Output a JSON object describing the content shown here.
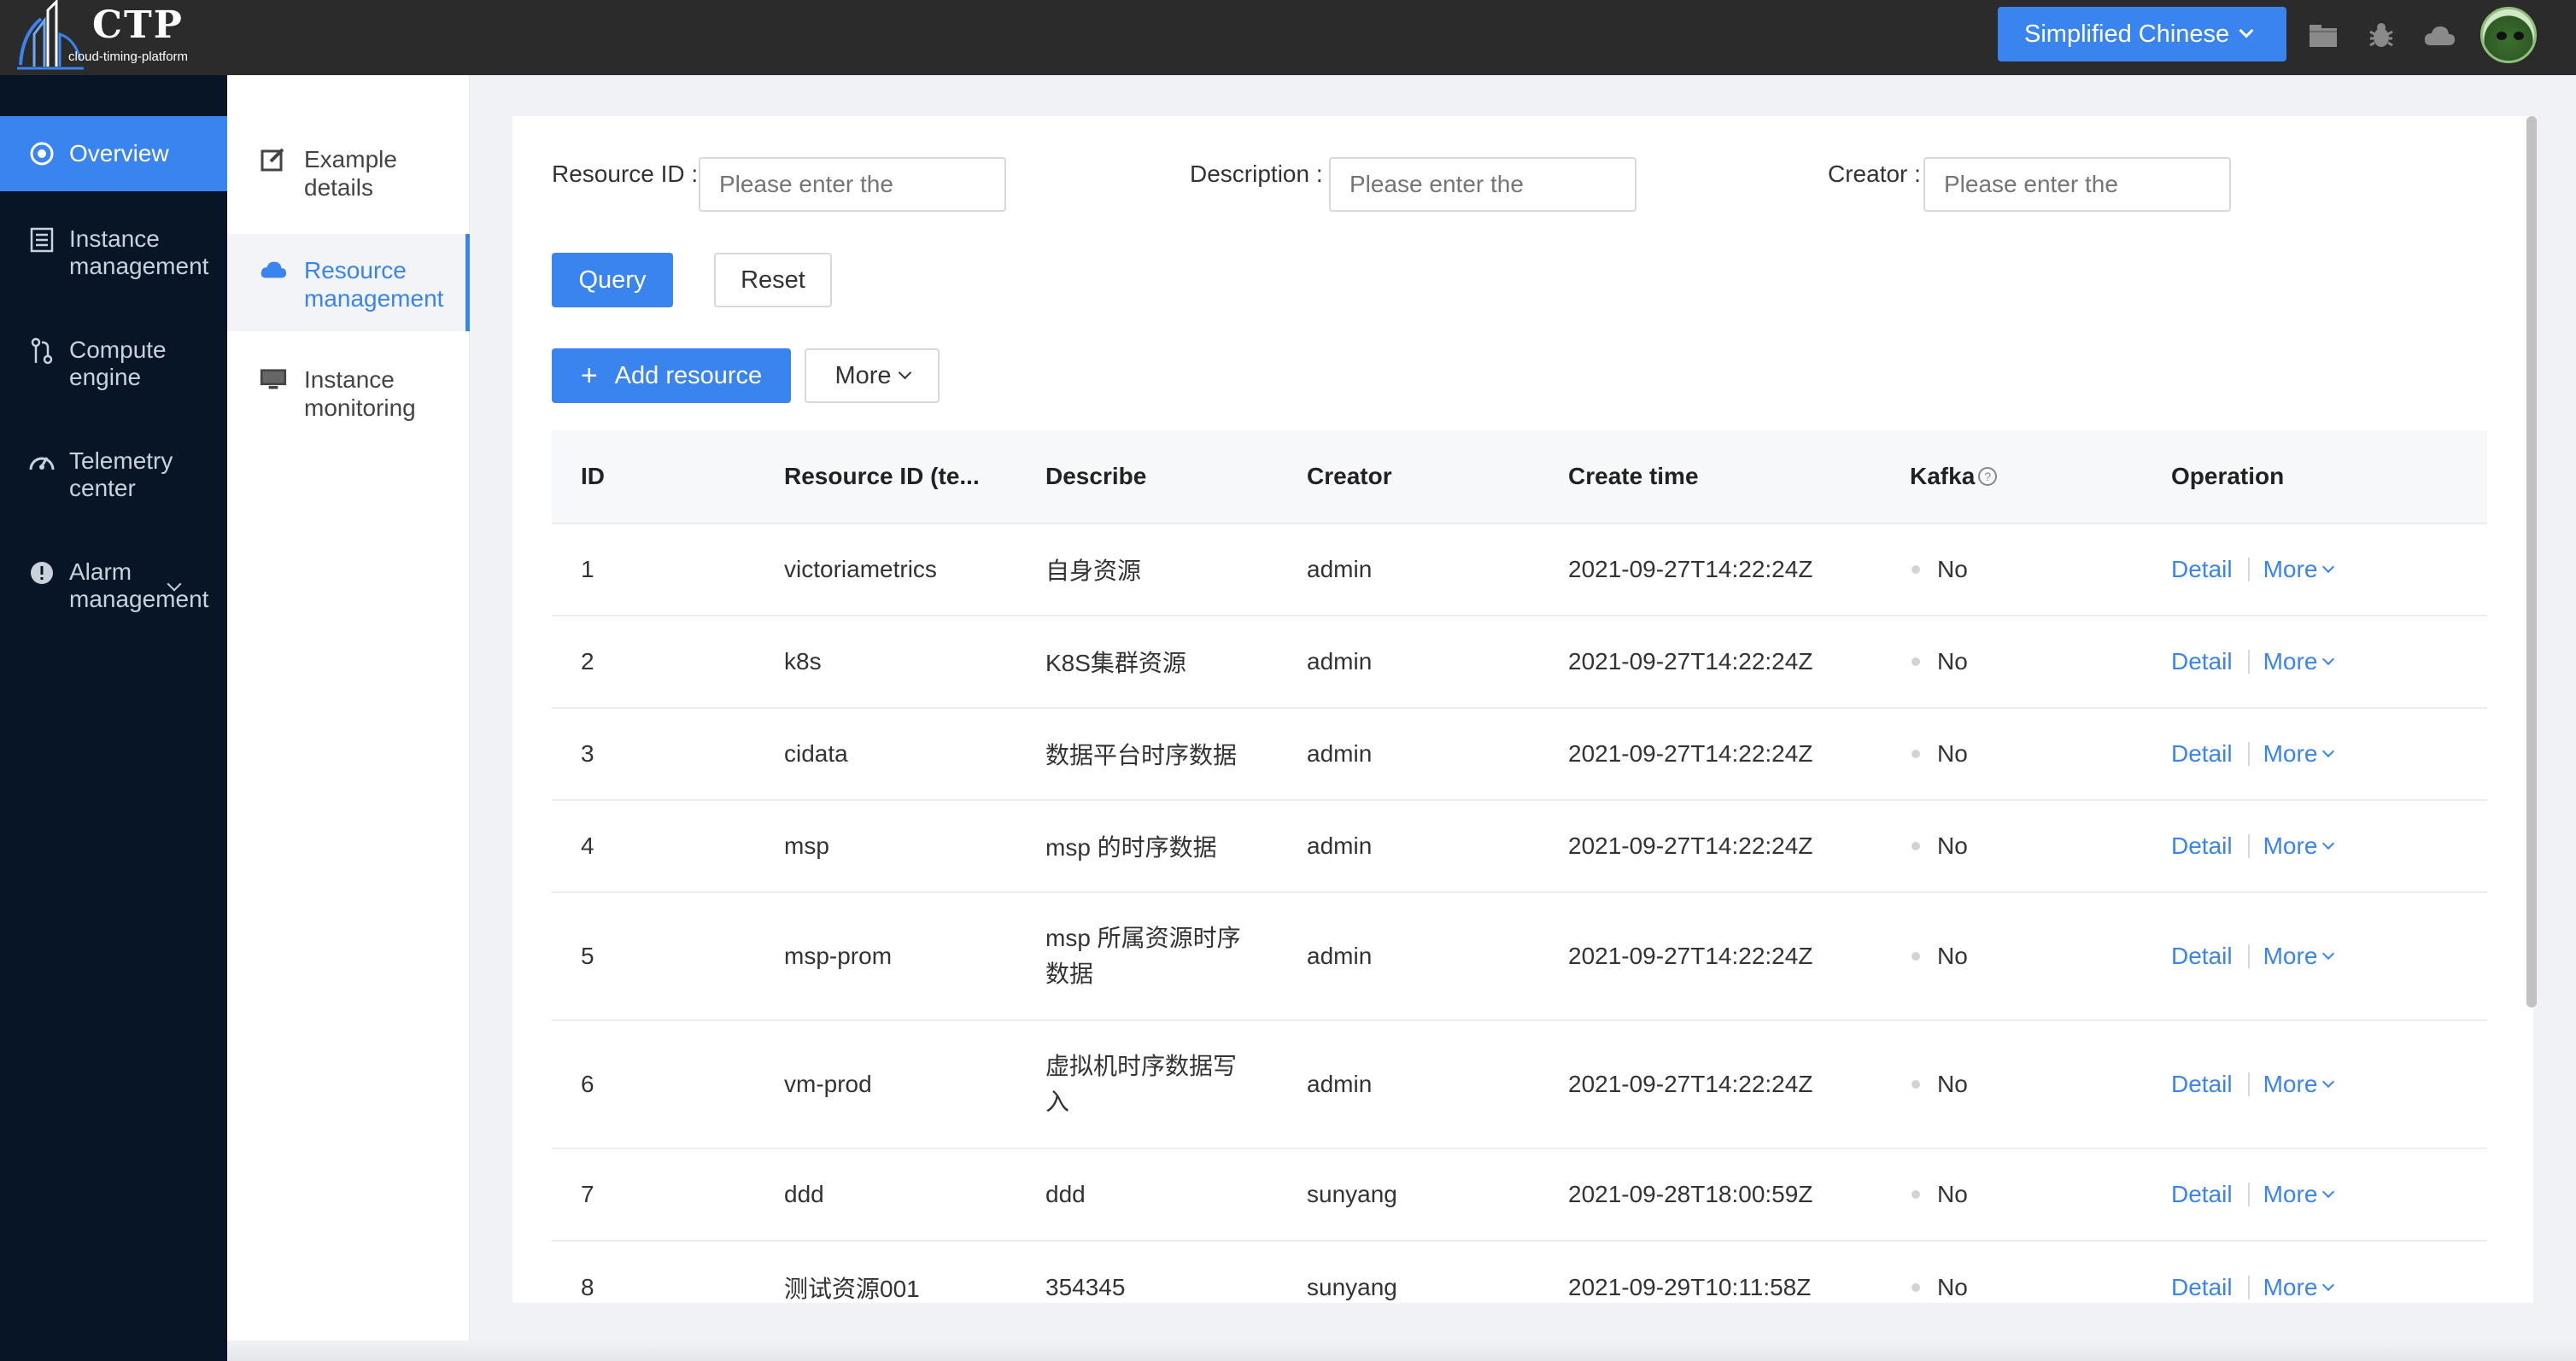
{
  "app": {
    "logo_title": "CTP",
    "logo_subtitle": "cloud-timing-platform"
  },
  "topbar": {
    "language_label": "Simplified Chinese",
    "icons": [
      "folder-icon",
      "bug-icon",
      "cloud-icon"
    ],
    "avatar": "user-avatar"
  },
  "sidebar": {
    "items": [
      {
        "label": "Overview",
        "icon": "target-icon",
        "active": true
      },
      {
        "label": "Instance management",
        "icon": "list-icon"
      },
      {
        "label": "Compute engine",
        "icon": "git-branch-icon"
      },
      {
        "label": "Telemetry center",
        "icon": "gauge-icon"
      },
      {
        "label": "Alarm management",
        "icon": "alert-icon",
        "expandable": true
      }
    ]
  },
  "submenu": {
    "items": [
      {
        "label": "Example details",
        "icon": "edit-icon"
      },
      {
        "label": "Resource management",
        "icon": "cloud-icon",
        "active": true
      },
      {
        "label": "Instance monitoring",
        "icon": "monitor-icon"
      }
    ]
  },
  "filters": {
    "resource_id": {
      "label": "Resource ID :",
      "placeholder": "Please enter the"
    },
    "description": {
      "label": "Description :",
      "placeholder": "Please enter the"
    },
    "creator": {
      "label": "Creator :",
      "placeholder": "Please enter the"
    }
  },
  "actions": {
    "query": "Query",
    "reset": "Reset",
    "add_resource": "Add resource",
    "add_icon": "+",
    "more": "More"
  },
  "table": {
    "headers": {
      "id": "ID",
      "resource_id": "Resource ID (te...",
      "describe": "Describe",
      "creator": "Creator",
      "create_time": "Create time",
      "kafka": "Kafka",
      "kafka_help": "?",
      "operation": "Operation"
    },
    "rows": [
      {
        "id": "1",
        "resource_id": "victoriametrics",
        "describe": "自身资源",
        "creator": "admin",
        "create_time": "2021-09-27T14:22:24Z",
        "kafka": "No",
        "detail": "Detail",
        "more": "More"
      },
      {
        "id": "2",
        "resource_id": "k8s",
        "describe": "K8S集群资源",
        "creator": "admin",
        "create_time": "2021-09-27T14:22:24Z",
        "kafka": "No",
        "detail": "Detail",
        "more": "More"
      },
      {
        "id": "3",
        "resource_id": "cidata",
        "describe": "数据平台时序数据",
        "creator": "admin",
        "create_time": "2021-09-27T14:22:24Z",
        "kafka": "No",
        "detail": "Detail",
        "more": "More"
      },
      {
        "id": "4",
        "resource_id": "msp",
        "describe": "msp 的时序数据",
        "creator": "admin",
        "create_time": "2021-09-27T14:22:24Z",
        "kafka": "No",
        "detail": "Detail",
        "more": "More"
      },
      {
        "id": "5",
        "resource_id": "msp-prom",
        "describe_line1": "msp 所属资源时序",
        "describe_line2": "数据",
        "creator": "admin",
        "create_time": "2021-09-27T14:22:24Z",
        "kafka": "No",
        "detail": "Detail",
        "more": "More"
      },
      {
        "id": "6",
        "resource_id": "vm-prod",
        "describe_line1": "虚拟机时序数据写",
        "describe_line2": "入",
        "creator": "admin",
        "create_time": "2021-09-27T14:22:24Z",
        "kafka": "No",
        "detail": "Detail",
        "more": "More"
      },
      {
        "id": "7",
        "resource_id": "ddd",
        "describe": "ddd",
        "creator": "sunyang",
        "create_time": "2021-09-28T18:00:59Z",
        "kafka": "No",
        "detail": "Detail",
        "more": "More"
      },
      {
        "id": "8",
        "resource_id": "测试资源001",
        "describe": "354345",
        "creator": "sunyang",
        "create_time": "2021-09-29T10:11:58Z",
        "kafka": "No",
        "detail": "Detail",
        "more": "More"
      }
    ]
  },
  "colors": {
    "primary": "#3a84ef",
    "sidebar_bg": "#081527",
    "topbar_bg": "#2b2b2b"
  }
}
